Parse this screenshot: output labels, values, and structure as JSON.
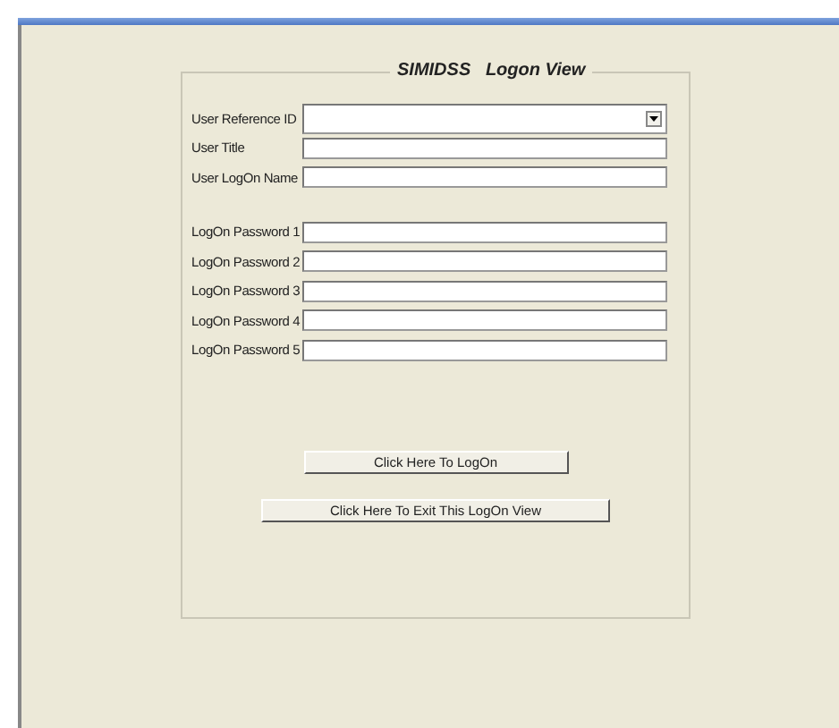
{
  "panel": {
    "title": "SIMIDSS   Logon View"
  },
  "field_groups": [
    [
      {
        "label": "User Reference ID",
        "kind": "dropdown"
      }
    ],
    [
      {
        "label": "User Title",
        "kind": "text"
      },
      {
        "label": "User LogOn Name",
        "kind": "text"
      }
    ],
    [
      {
        "label": "LogOn Password 1",
        "kind": "text"
      },
      {
        "label": "LogOn Password 2",
        "kind": "text"
      },
      {
        "label": "LogOn Password 3",
        "kind": "text"
      },
      {
        "label": "LogOn Password 4",
        "kind": "text"
      },
      {
        "label": "LogOn Password 5",
        "kind": "text"
      }
    ]
  ],
  "buttons": [
    "Click Here To LogOn",
    "Click Here To Exit This LogOn View"
  ]
}
